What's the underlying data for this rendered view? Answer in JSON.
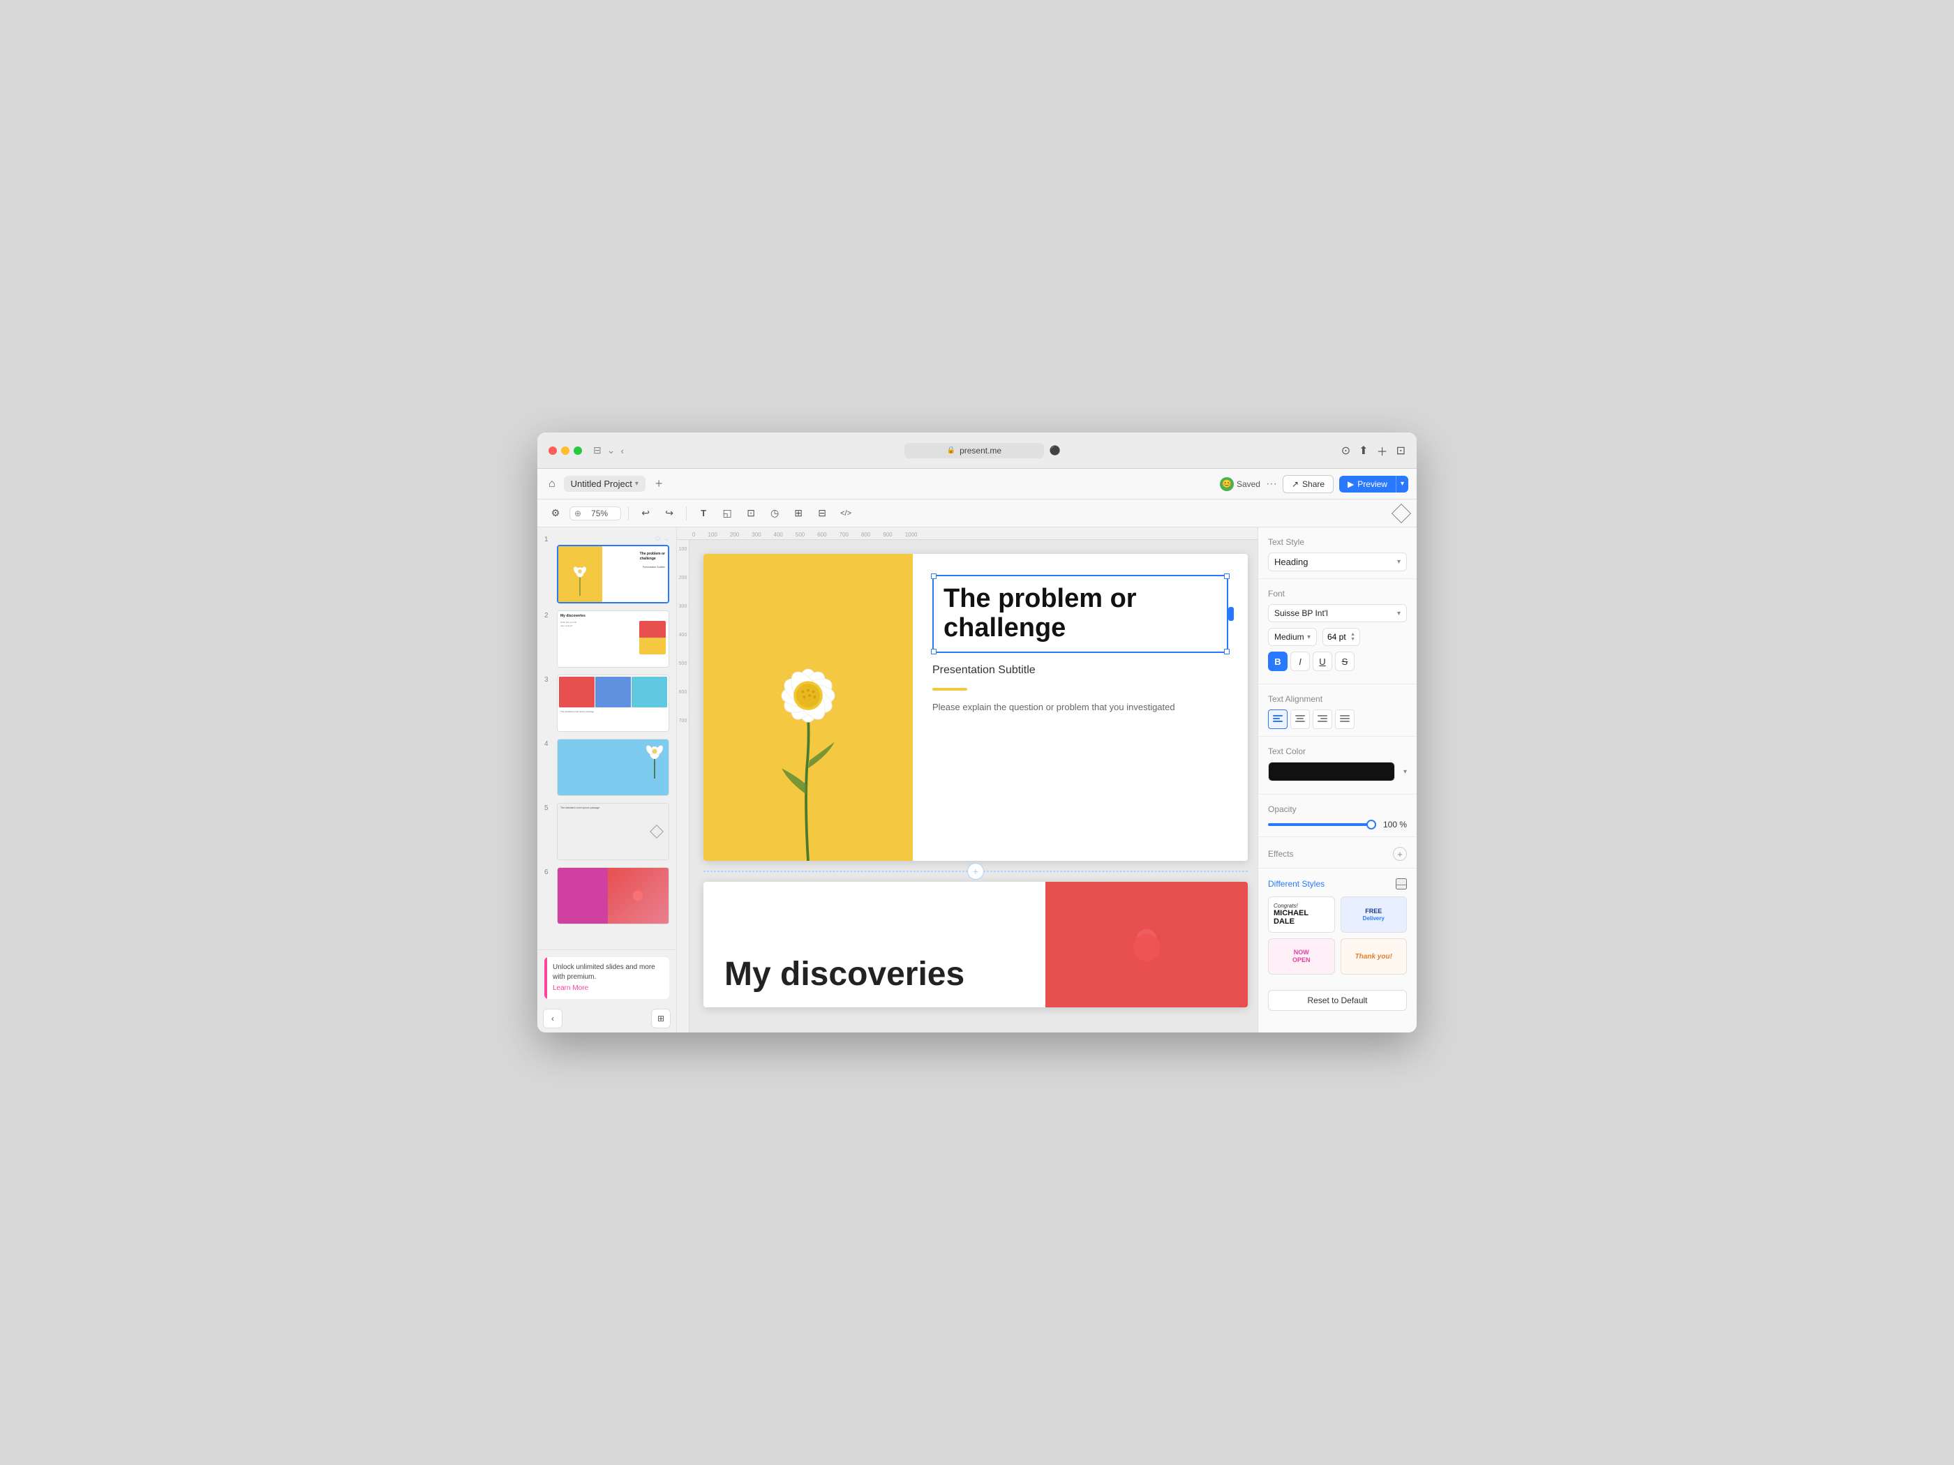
{
  "browser": {
    "url": "present.me",
    "lock_symbol": "🔒"
  },
  "toolbar": {
    "home_label": "⌂",
    "project_name": "Untitled Project",
    "add_slide_label": "+",
    "zoom_label": "75%",
    "share_label": "Share",
    "preview_label": "Preview",
    "saved_label": "Saved",
    "more_label": "···"
  },
  "tools": {
    "settings": "⚙",
    "zoom_in": "+",
    "undo": "↩",
    "redo": "↪",
    "text": "T",
    "shapes": "◱",
    "images": "⊡",
    "timer": "◷",
    "table": "⊞",
    "grid": "⊟",
    "code": "</>",
    "diamond": "",
    "zoom_label": "75%"
  },
  "ruler": {
    "ticks": [
      "0",
      "100",
      "200",
      "300",
      "400",
      "500",
      "600",
      "700",
      "800",
      "900",
      "1000"
    ]
  },
  "slides": [
    {
      "number": "1",
      "active": true,
      "title": "The problem or challenge",
      "subtitle": "Presentation Subtitle"
    },
    {
      "number": "2",
      "active": false,
      "title": "My discoveries"
    },
    {
      "number": "3",
      "active": false,
      "title": ""
    },
    {
      "number": "4",
      "active": false,
      "title": ""
    },
    {
      "number": "5",
      "active": false,
      "title": ""
    },
    {
      "number": "6",
      "active": false,
      "title": ""
    }
  ],
  "premium": {
    "text": "Unlock unlimited slides and more with premium.",
    "link_label": "Learn More"
  },
  "canvas": {
    "slide1": {
      "heading": "The problem or challenge",
      "subtitle": "Presentation Subtitle",
      "body": "Please explain the question or problem that you investigated"
    },
    "slide2": {
      "heading": "My discoveries"
    }
  },
  "right_panel": {
    "text_style_label": "Text Style",
    "text_style_value": "Heading",
    "font_label": "Font",
    "font_name": "Suisse BP Int'l",
    "font_weight": "Medium",
    "font_size": "64 pt",
    "bold_label": "B",
    "italic_label": "I",
    "underline_label": "U",
    "strikethrough_label": "S",
    "text_alignment_label": "Text Alignment",
    "text_color_label": "Text Color",
    "text_color_value": "#111111",
    "opacity_label": "Opacity",
    "opacity_value": "100 %",
    "effects_label": "Effects",
    "different_styles_label": "Different Styles",
    "reset_default_label": "Reset to Default"
  },
  "style_presets": [
    {
      "id": "congrats",
      "line1": "Congrats!",
      "line2": "MICHAEL",
      "line3": "DALE",
      "color": "black"
    },
    {
      "id": "free-delivery",
      "text": "FREE Delivery",
      "color": "blue"
    },
    {
      "id": "now-open",
      "text": "NOW OPEN",
      "color": "pink"
    },
    {
      "id": "thank-you",
      "text": "Thank you!",
      "color": "orange"
    }
  ]
}
